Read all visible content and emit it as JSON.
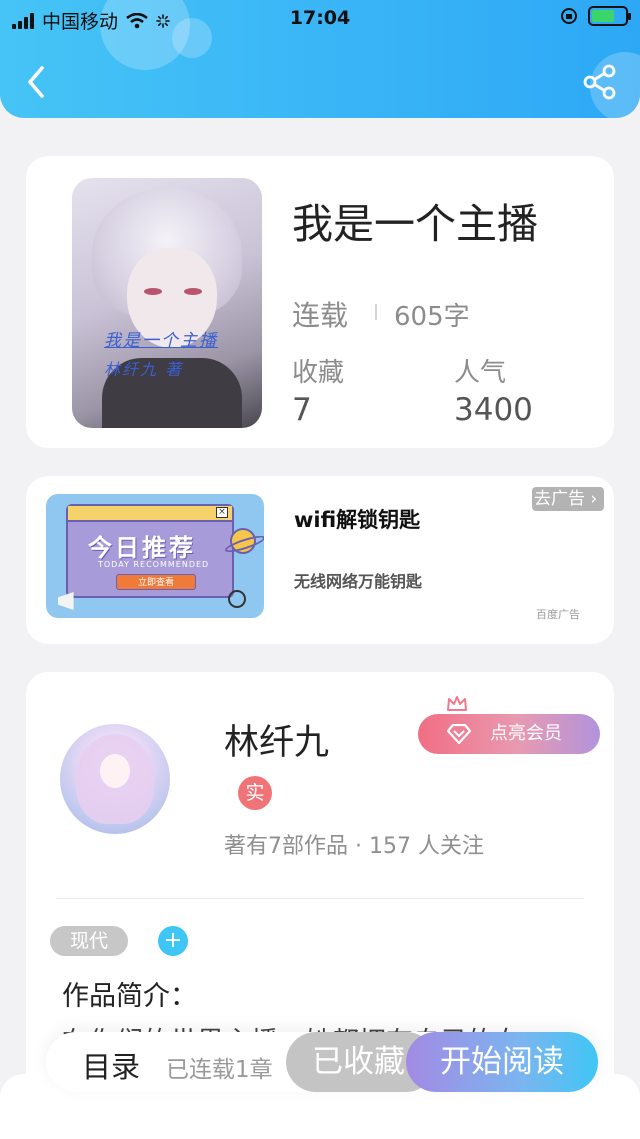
{
  "status_bar": {
    "carrier": "中国移动",
    "time": "17:04"
  },
  "book": {
    "title": "我是一个主播",
    "status": "连载",
    "word_count": "605字",
    "favorites_label": "收藏",
    "favorites_value": "7",
    "popularity_label": "人气",
    "popularity_value": "3400",
    "cover_text_line1": "我是一个主播",
    "cover_text_line2": "林纤九 著"
  },
  "ad": {
    "title": "wifi解锁钥匙",
    "description": "无线网络万能钥匙",
    "source": "百度广告",
    "close_label": "去广告 ›",
    "banner_main": "今日推荐",
    "banner_sub": "TODAY RECOMMENDED",
    "banner_button": "立即查看"
  },
  "author": {
    "name": "林纤九",
    "verified_badge": "实",
    "meta": "著有7部作品 · 157 人关注",
    "vip_button": "点亮会员"
  },
  "tags": [
    "现代"
  ],
  "add_tag_label": "+",
  "intro": {
    "label": "作品简介：",
    "text": "在你们的世界主播，她都拥有自己的女"
  },
  "bottom_bar": {
    "toc_label": "目录",
    "toc_meta": "已连载1章",
    "collected_label": "已收藏",
    "read_label": "开始阅读"
  },
  "colors": {
    "header_start": "#46c4f6",
    "header_end": "#2da8f5",
    "accent": "#3fc6f5",
    "vip_gradient_start": "#f16e84",
    "vip_gradient_end": "#b293dc",
    "read_gradient_start": "#a38ae3",
    "read_gradient_end": "#3fc6f5"
  }
}
